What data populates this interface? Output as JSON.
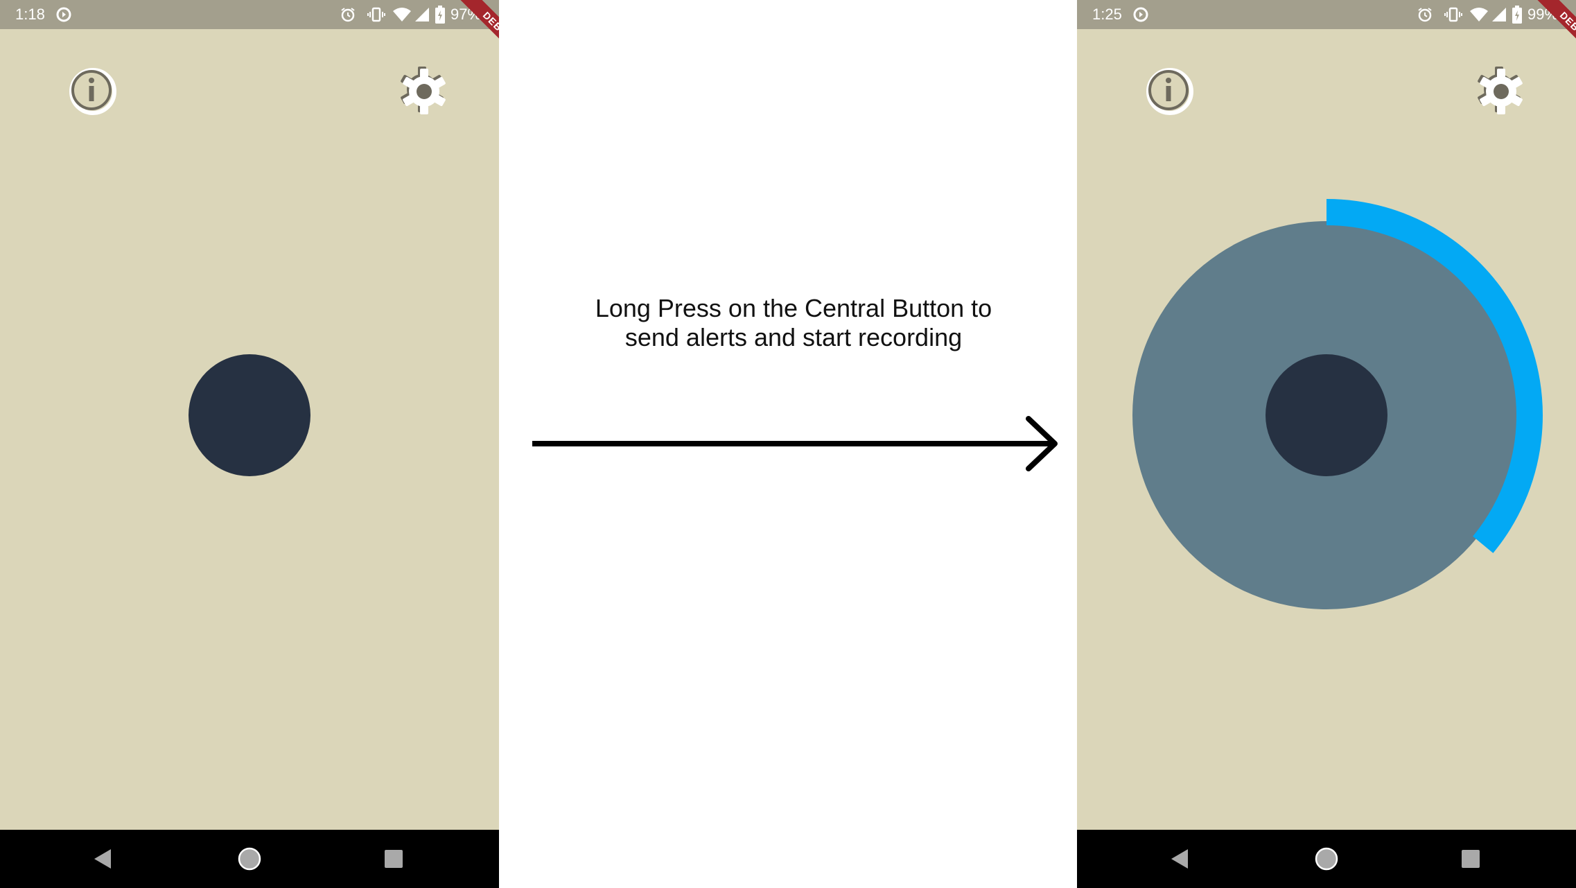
{
  "left_screen": {
    "status_time": "1:18",
    "battery": "97%",
    "debug_label": "DEBUG",
    "recording_progress": 0
  },
  "right_screen": {
    "status_time": "1:25",
    "battery": "99%",
    "debug_label": "DEBUG",
    "recording_progress": 0.36
  },
  "caption": {
    "line1": "Long Press on the Central Button to",
    "line2": "send alerts and start recording"
  },
  "colors": {
    "app_background": "#dbd6b9",
    "status_bar": "#a39f8d",
    "central_button": "#263142",
    "ring": "#607d8b",
    "progress_arc": "#03a9f4",
    "debug_ribbon": "#a4262c"
  },
  "icons": {
    "info": "info-icon",
    "settings": "gear-icon",
    "back": "back-triangle-icon",
    "home": "home-circle-icon",
    "recents": "recents-square-icon",
    "arrow": "right-arrow-icon"
  }
}
